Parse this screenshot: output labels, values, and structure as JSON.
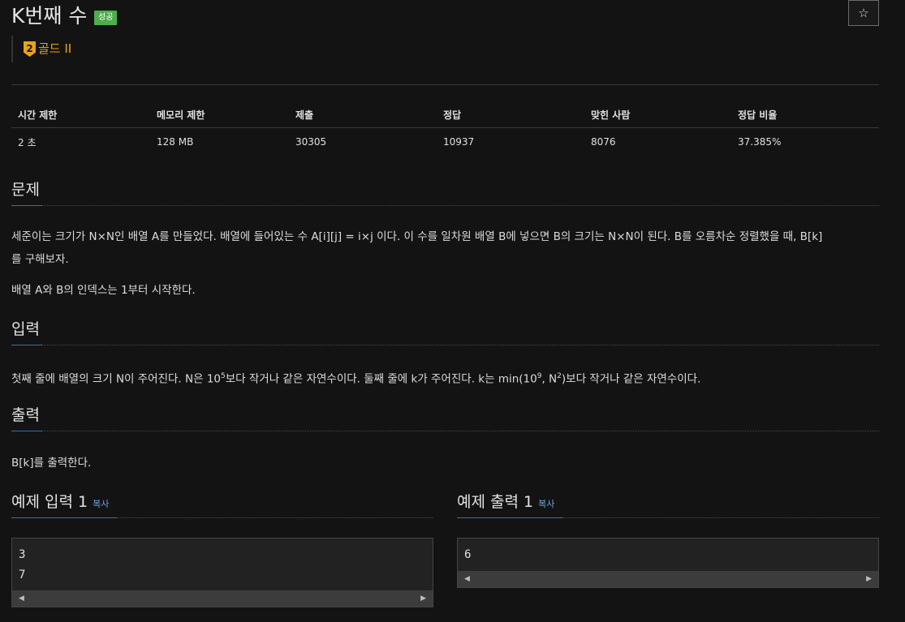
{
  "problem": {
    "title": "K번째 수",
    "status_badge": "성공",
    "star_label": "☆",
    "tier_number": "2",
    "tier_label": "골드 II"
  },
  "info_table": {
    "headers": [
      "시간 제한",
      "메모리 제한",
      "제출",
      "정답",
      "맞힌 사람",
      "정답 비율"
    ],
    "values": [
      "2 초",
      "128 MB",
      "30305",
      "10937",
      "8076",
      "37.385%"
    ]
  },
  "description": {
    "heading": "문제",
    "line1": "세준이는 크기가 N×N인 배열 A를 만들었다. 배열에 들어있는 수 A[i][j] = i×j 이다. 이 수를 일차원 배열 B에 넣으면 B의 크기는 N×N이 된다. B를 오름차순 정렬했을 때, B[k]",
    "line2": "를 구해보자.",
    "line3": "배열 A와 B의 인덱스는 1부터 시작한다."
  },
  "input_section": {
    "heading": "입력",
    "part1": "첫째 줄에 배열의 크기 N이 주어진다. N은 10",
    "sup1": "5",
    "part2": "보다 작거나 같은 자연수이다. 둘째 줄에 k가 주어진다. k는 min(10",
    "sup2": "9",
    "part3": ", N",
    "sup3": "2",
    "part4": ")보다 작거나 같은 자연수이다."
  },
  "output_section": {
    "heading": "출력",
    "text": "B[k]를 출력한다."
  },
  "samples": {
    "input_title": "예제 입력 1",
    "output_title": "예제 출력 1",
    "copy_label": "복사",
    "input_lines": [
      "3",
      "7"
    ],
    "output_lines": [
      "6"
    ],
    "scroll_left": "◀",
    "scroll_right": "▶"
  }
}
